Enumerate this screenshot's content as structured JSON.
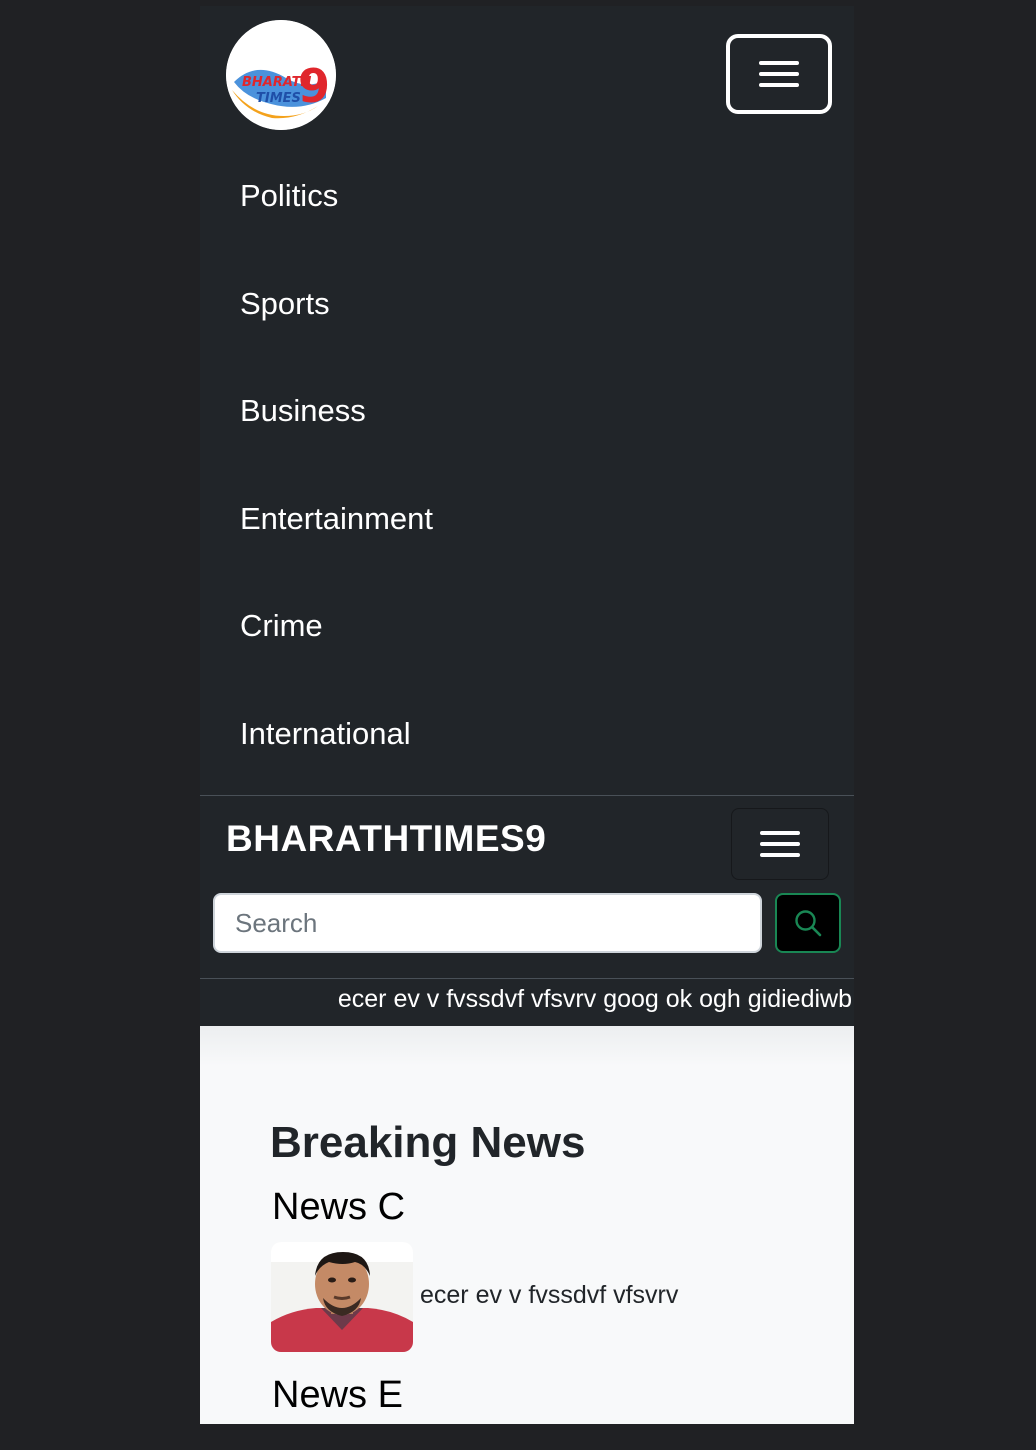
{
  "logo": {
    "line1": "BHARATH",
    "line2": "TIMES",
    "numeral": "9"
  },
  "nav": {
    "items": [
      "Politics",
      "Sports",
      "Business",
      "Entertainment",
      "Crime",
      "International"
    ]
  },
  "brand": {
    "title": "BHARATHTIMES9"
  },
  "search": {
    "placeholder": "Search"
  },
  "ticker": {
    "text": "ecer ev v fvssdvf vfsvrv goog ok ogh gidiediwb"
  },
  "content": {
    "section_title": "Breaking News",
    "news": [
      {
        "title": "News C",
        "excerpt": "ecer ev v fvssdvf vfsvrv"
      },
      {
        "title": "News E"
      }
    ]
  },
  "colors": {
    "dark_bg": "#212529",
    "page_bg": "#202124",
    "content_bg": "#f8f9fa",
    "search_button_border": "#198754"
  },
  "icons": {
    "menu": "hamburger-icon",
    "search": "search-icon"
  }
}
